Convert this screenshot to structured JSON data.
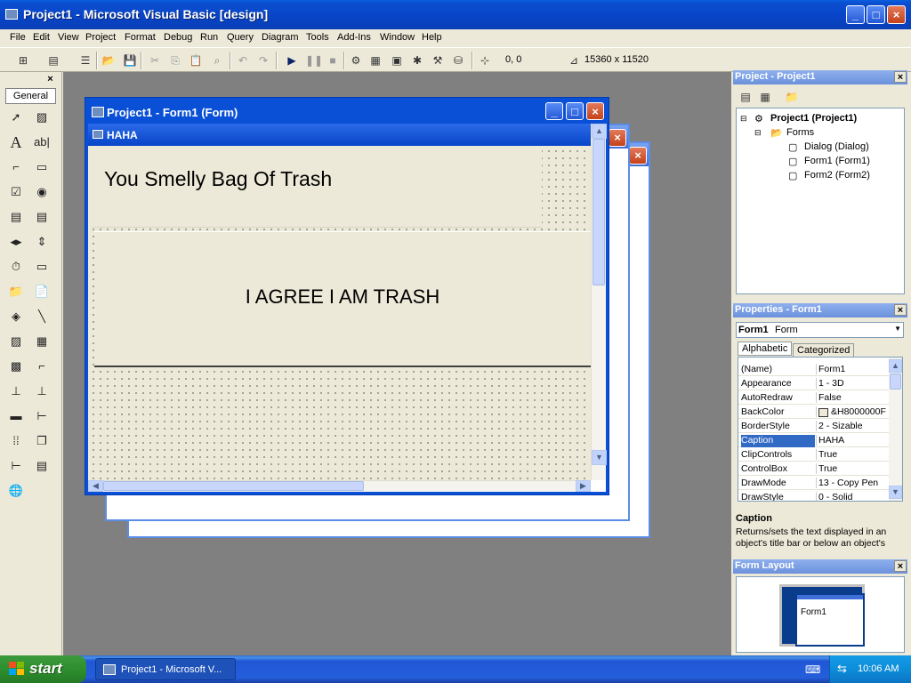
{
  "app": {
    "title": "Project1 - Microsoft Visual Basic [design]"
  },
  "menu": [
    "File",
    "Edit",
    "View",
    "Project",
    "Format",
    "Debug",
    "Run",
    "Query",
    "Diagram",
    "Tools",
    "Add-Ins",
    "Window",
    "Help"
  ],
  "toolbar": {
    "position": "0, 0",
    "size": "15360 x 11520"
  },
  "toolbox": {
    "tab_label": "General"
  },
  "designer": {
    "window_title": "Project1 - Form1 (Form)",
    "form_caption": "HAHA",
    "label_text": "You Smelly Bag Of Trash",
    "button_text": "I AGREE I AM TRASH"
  },
  "project_explorer": {
    "title": "Project - Project1",
    "root": "Project1 (Project1)",
    "folder": "Forms",
    "items": [
      "Dialog (Dialog)",
      "Form1 (Form1)",
      "Form2 (Form2)"
    ]
  },
  "properties": {
    "title": "Properties - Form1",
    "object_name": "Form1",
    "object_type": "Form",
    "tabs": [
      "Alphabetic",
      "Categorized"
    ],
    "rows": [
      {
        "name": "(Name)",
        "value": "Form1"
      },
      {
        "name": "Appearance",
        "value": "1 - 3D"
      },
      {
        "name": "AutoRedraw",
        "value": "False"
      },
      {
        "name": "BackColor",
        "value": "&H8000000F"
      },
      {
        "name": "BorderStyle",
        "value": "2 - Sizable"
      },
      {
        "name": "Caption",
        "value": "HAHA"
      },
      {
        "name": "ClipControls",
        "value": "True"
      },
      {
        "name": "ControlBox",
        "value": "True"
      },
      {
        "name": "DrawMode",
        "value": "13 - Copy Pen"
      },
      {
        "name": "DrawStyle",
        "value": "0 - Solid"
      }
    ],
    "desc_title": "Caption",
    "desc_text": "Returns/sets the text displayed in an object's title bar or below an object's"
  },
  "form_layout": {
    "title": "Form Layout",
    "form_label": "Form1"
  },
  "taskbar": {
    "start": "start",
    "task": "Project1 - Microsoft V...",
    "clock": "10:06 AM"
  }
}
